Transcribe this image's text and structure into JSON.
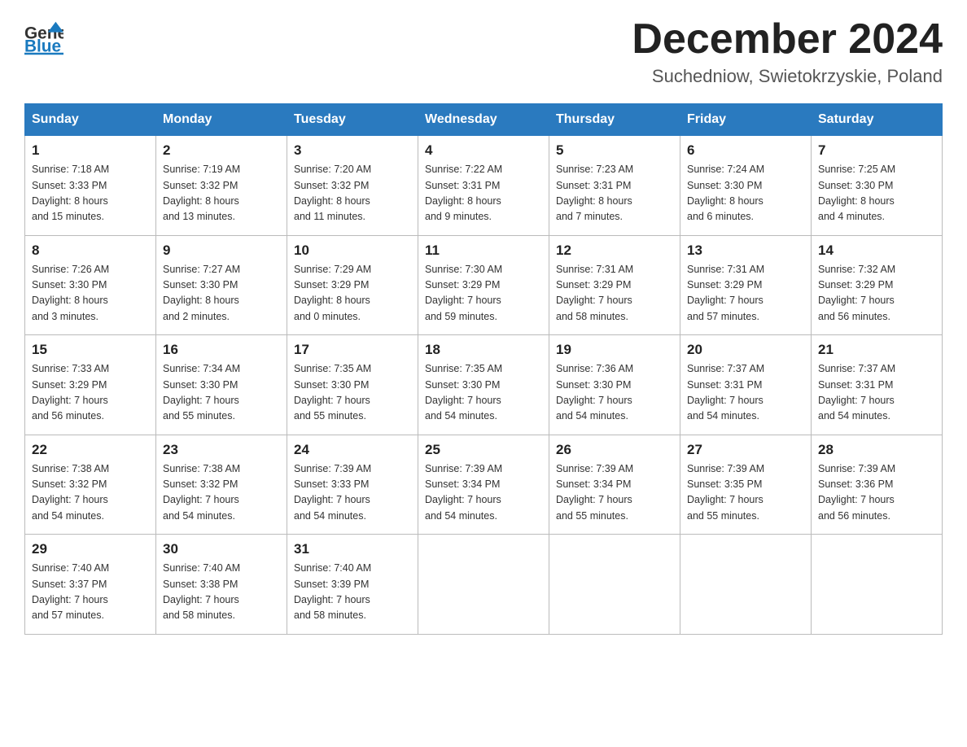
{
  "header": {
    "logo": {
      "general": "General",
      "blue": "Blue"
    },
    "title": "December 2024",
    "subtitle": "Suchedniow, Swietokrzyskie, Poland"
  },
  "days_of_week": [
    "Sunday",
    "Monday",
    "Tuesday",
    "Wednesday",
    "Thursday",
    "Friday",
    "Saturday"
  ],
  "weeks": [
    [
      {
        "day": "1",
        "sunrise": "Sunrise: 7:18 AM",
        "sunset": "Sunset: 3:33 PM",
        "daylight": "Daylight: 8 hours",
        "minutes": "and 15 minutes."
      },
      {
        "day": "2",
        "sunrise": "Sunrise: 7:19 AM",
        "sunset": "Sunset: 3:32 PM",
        "daylight": "Daylight: 8 hours",
        "minutes": "and 13 minutes."
      },
      {
        "day": "3",
        "sunrise": "Sunrise: 7:20 AM",
        "sunset": "Sunset: 3:32 PM",
        "daylight": "Daylight: 8 hours",
        "minutes": "and 11 minutes."
      },
      {
        "day": "4",
        "sunrise": "Sunrise: 7:22 AM",
        "sunset": "Sunset: 3:31 PM",
        "daylight": "Daylight: 8 hours",
        "minutes": "and 9 minutes."
      },
      {
        "day": "5",
        "sunrise": "Sunrise: 7:23 AM",
        "sunset": "Sunset: 3:31 PM",
        "daylight": "Daylight: 8 hours",
        "minutes": "and 7 minutes."
      },
      {
        "day": "6",
        "sunrise": "Sunrise: 7:24 AM",
        "sunset": "Sunset: 3:30 PM",
        "daylight": "Daylight: 8 hours",
        "minutes": "and 6 minutes."
      },
      {
        "day": "7",
        "sunrise": "Sunrise: 7:25 AM",
        "sunset": "Sunset: 3:30 PM",
        "daylight": "Daylight: 8 hours",
        "minutes": "and 4 minutes."
      }
    ],
    [
      {
        "day": "8",
        "sunrise": "Sunrise: 7:26 AM",
        "sunset": "Sunset: 3:30 PM",
        "daylight": "Daylight: 8 hours",
        "minutes": "and 3 minutes."
      },
      {
        "day": "9",
        "sunrise": "Sunrise: 7:27 AM",
        "sunset": "Sunset: 3:30 PM",
        "daylight": "Daylight: 8 hours",
        "minutes": "and 2 minutes."
      },
      {
        "day": "10",
        "sunrise": "Sunrise: 7:29 AM",
        "sunset": "Sunset: 3:29 PM",
        "daylight": "Daylight: 8 hours",
        "minutes": "and 0 minutes."
      },
      {
        "day": "11",
        "sunrise": "Sunrise: 7:30 AM",
        "sunset": "Sunset: 3:29 PM",
        "daylight": "Daylight: 7 hours",
        "minutes": "and 59 minutes."
      },
      {
        "day": "12",
        "sunrise": "Sunrise: 7:31 AM",
        "sunset": "Sunset: 3:29 PM",
        "daylight": "Daylight: 7 hours",
        "minutes": "and 58 minutes."
      },
      {
        "day": "13",
        "sunrise": "Sunrise: 7:31 AM",
        "sunset": "Sunset: 3:29 PM",
        "daylight": "Daylight: 7 hours",
        "minutes": "and 57 minutes."
      },
      {
        "day": "14",
        "sunrise": "Sunrise: 7:32 AM",
        "sunset": "Sunset: 3:29 PM",
        "daylight": "Daylight: 7 hours",
        "minutes": "and 56 minutes."
      }
    ],
    [
      {
        "day": "15",
        "sunrise": "Sunrise: 7:33 AM",
        "sunset": "Sunset: 3:29 PM",
        "daylight": "Daylight: 7 hours",
        "minutes": "and 56 minutes."
      },
      {
        "day": "16",
        "sunrise": "Sunrise: 7:34 AM",
        "sunset": "Sunset: 3:30 PM",
        "daylight": "Daylight: 7 hours",
        "minutes": "and 55 minutes."
      },
      {
        "day": "17",
        "sunrise": "Sunrise: 7:35 AM",
        "sunset": "Sunset: 3:30 PM",
        "daylight": "Daylight: 7 hours",
        "minutes": "and 55 minutes."
      },
      {
        "day": "18",
        "sunrise": "Sunrise: 7:35 AM",
        "sunset": "Sunset: 3:30 PM",
        "daylight": "Daylight: 7 hours",
        "minutes": "and 54 minutes."
      },
      {
        "day": "19",
        "sunrise": "Sunrise: 7:36 AM",
        "sunset": "Sunset: 3:30 PM",
        "daylight": "Daylight: 7 hours",
        "minutes": "and 54 minutes."
      },
      {
        "day": "20",
        "sunrise": "Sunrise: 7:37 AM",
        "sunset": "Sunset: 3:31 PM",
        "daylight": "Daylight: 7 hours",
        "minutes": "and 54 minutes."
      },
      {
        "day": "21",
        "sunrise": "Sunrise: 7:37 AM",
        "sunset": "Sunset: 3:31 PM",
        "daylight": "Daylight: 7 hours",
        "minutes": "and 54 minutes."
      }
    ],
    [
      {
        "day": "22",
        "sunrise": "Sunrise: 7:38 AM",
        "sunset": "Sunset: 3:32 PM",
        "daylight": "Daylight: 7 hours",
        "minutes": "and 54 minutes."
      },
      {
        "day": "23",
        "sunrise": "Sunrise: 7:38 AM",
        "sunset": "Sunset: 3:32 PM",
        "daylight": "Daylight: 7 hours",
        "minutes": "and 54 minutes."
      },
      {
        "day": "24",
        "sunrise": "Sunrise: 7:39 AM",
        "sunset": "Sunset: 3:33 PM",
        "daylight": "Daylight: 7 hours",
        "minutes": "and 54 minutes."
      },
      {
        "day": "25",
        "sunrise": "Sunrise: 7:39 AM",
        "sunset": "Sunset: 3:34 PM",
        "daylight": "Daylight: 7 hours",
        "minutes": "and 54 minutes."
      },
      {
        "day": "26",
        "sunrise": "Sunrise: 7:39 AM",
        "sunset": "Sunset: 3:34 PM",
        "daylight": "Daylight: 7 hours",
        "minutes": "and 55 minutes."
      },
      {
        "day": "27",
        "sunrise": "Sunrise: 7:39 AM",
        "sunset": "Sunset: 3:35 PM",
        "daylight": "Daylight: 7 hours",
        "minutes": "and 55 minutes."
      },
      {
        "day": "28",
        "sunrise": "Sunrise: 7:39 AM",
        "sunset": "Sunset: 3:36 PM",
        "daylight": "Daylight: 7 hours",
        "minutes": "and 56 minutes."
      }
    ],
    [
      {
        "day": "29",
        "sunrise": "Sunrise: 7:40 AM",
        "sunset": "Sunset: 3:37 PM",
        "daylight": "Daylight: 7 hours",
        "minutes": "and 57 minutes."
      },
      {
        "day": "30",
        "sunrise": "Sunrise: 7:40 AM",
        "sunset": "Sunset: 3:38 PM",
        "daylight": "Daylight: 7 hours",
        "minutes": "and 58 minutes."
      },
      {
        "day": "31",
        "sunrise": "Sunrise: 7:40 AM",
        "sunset": "Sunset: 3:39 PM",
        "daylight": "Daylight: 7 hours",
        "minutes": "and 58 minutes."
      },
      null,
      null,
      null,
      null
    ]
  ]
}
